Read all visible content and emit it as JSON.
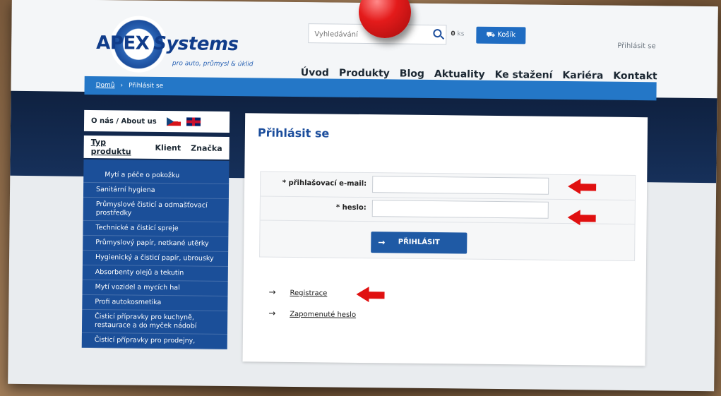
{
  "header": {
    "logo_main": "APEX",
    "logo_second": "Systems",
    "logo_sub": "pro auto, průmysl & úklid",
    "search_placeholder": "Vyhledávání",
    "cart_count": "0",
    "cart_count_unit": "ks",
    "cart_label": "Košík",
    "login_link": "Přihlásit se",
    "nav": [
      "Úvod",
      "Produkty",
      "Blog",
      "Aktuality",
      "Ke stažení",
      "Kariéra",
      "Kontakt"
    ]
  },
  "breadcrumb": {
    "home": "Domů",
    "separator": "›",
    "current": "Přihlásit se"
  },
  "sidebar": {
    "about": "O nás / About us",
    "tabs": [
      "Typ produktu",
      "Klient",
      "Značka"
    ],
    "items": [
      "Mytí a péče o pokožku",
      "Sanitární hygiena",
      "Průmyslové čisticí a odmašťovací prostředky",
      "Technické a čisticí spreje",
      "Průmyslový papír, netkané utěrky",
      "Hygienický a čisticí papír, ubrousky",
      "Absorbenty olejů a tekutin",
      "Mytí vozidel a mycích hal",
      "Profi autokosmetika",
      "Čisticí přípravky pro kuchyně, restaurace a do myček nádobí",
      "Čisticí přípravky pro prodejny,"
    ]
  },
  "login": {
    "title": "Přihlásit se",
    "email_label": "* přihlašovací e-mail:",
    "password_label": "* heslo:",
    "submit_label": "PŘIHLÁSIT",
    "register_link": "Registrace",
    "forgot_link": "Zapomenuté heslo"
  },
  "colors": {
    "brand_blue": "#1b4d9c",
    "accent_red": "#e01010"
  }
}
